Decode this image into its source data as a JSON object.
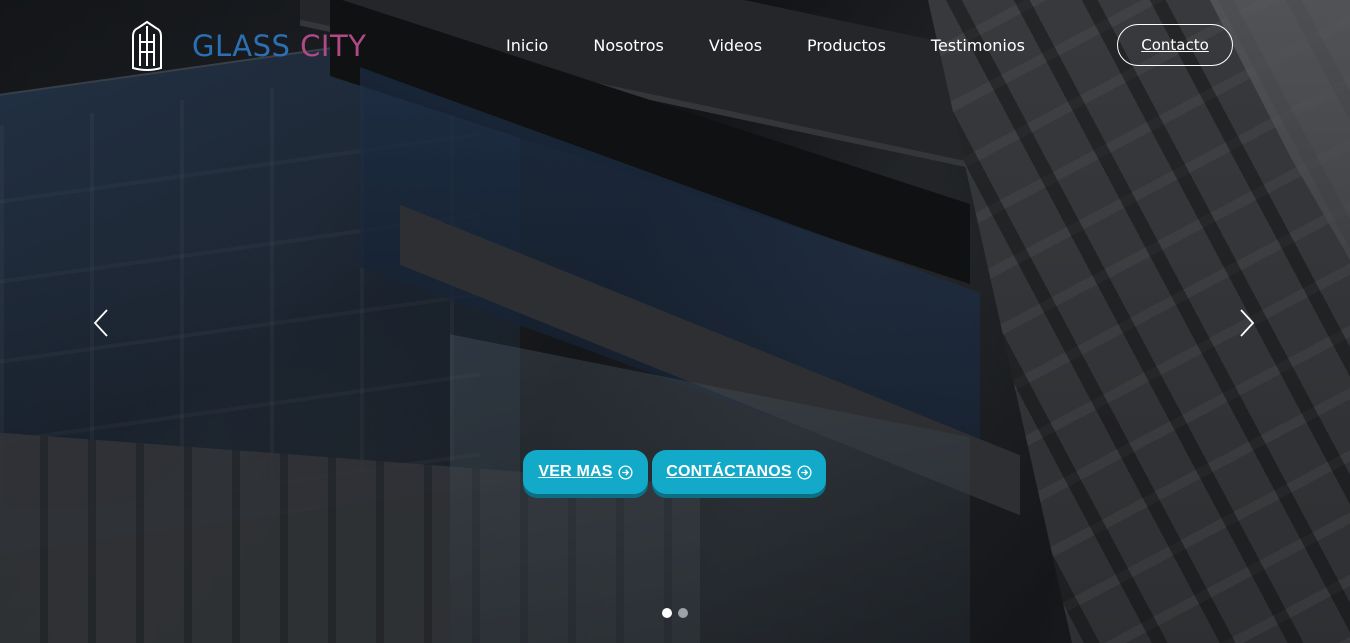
{
  "brand": {
    "name_part1": "GLASS",
    "name_part2": "CITY",
    "color_part1": "#2b6fb5",
    "color_part2": "#b04a86",
    "logo_icon": "building-icon"
  },
  "nav": {
    "items": [
      {
        "label": "Inicio"
      },
      {
        "label": "Nosotros"
      },
      {
        "label": "Videos"
      },
      {
        "label": "Productos"
      },
      {
        "label": "Testimonios"
      }
    ],
    "contact_label": "Contacto"
  },
  "hero": {
    "buttons": {
      "ver_mas": "VER MAS",
      "contactanos": "CONTÁCTANOS"
    },
    "button_icon": "arrow-circle-right-icon",
    "button_color": "#13a9c8",
    "slides_total": 2,
    "active_slide": 1
  }
}
